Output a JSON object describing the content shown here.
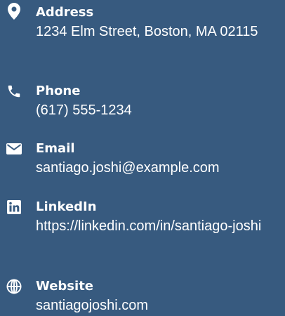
{
  "contacts": [
    {
      "icon": "map-marker-icon",
      "label": "Address",
      "value": "1234 Elm Street, Boston, MA 02115"
    },
    {
      "icon": "phone-icon",
      "label": "Phone",
      "value": "(617) 555-1234"
    },
    {
      "icon": "envelope-icon",
      "label": "Email",
      "value": "santiago.joshi@example.com"
    },
    {
      "icon": "linkedin-icon",
      "label": "LinkedIn",
      "value": "https://linkedin.com/in/santiago-joshi"
    },
    {
      "icon": "globe-icon",
      "label": "Website",
      "value": "santiagojoshi.com"
    }
  ],
  "colors": {
    "background": "#375a7f",
    "text": "#ffffff"
  }
}
